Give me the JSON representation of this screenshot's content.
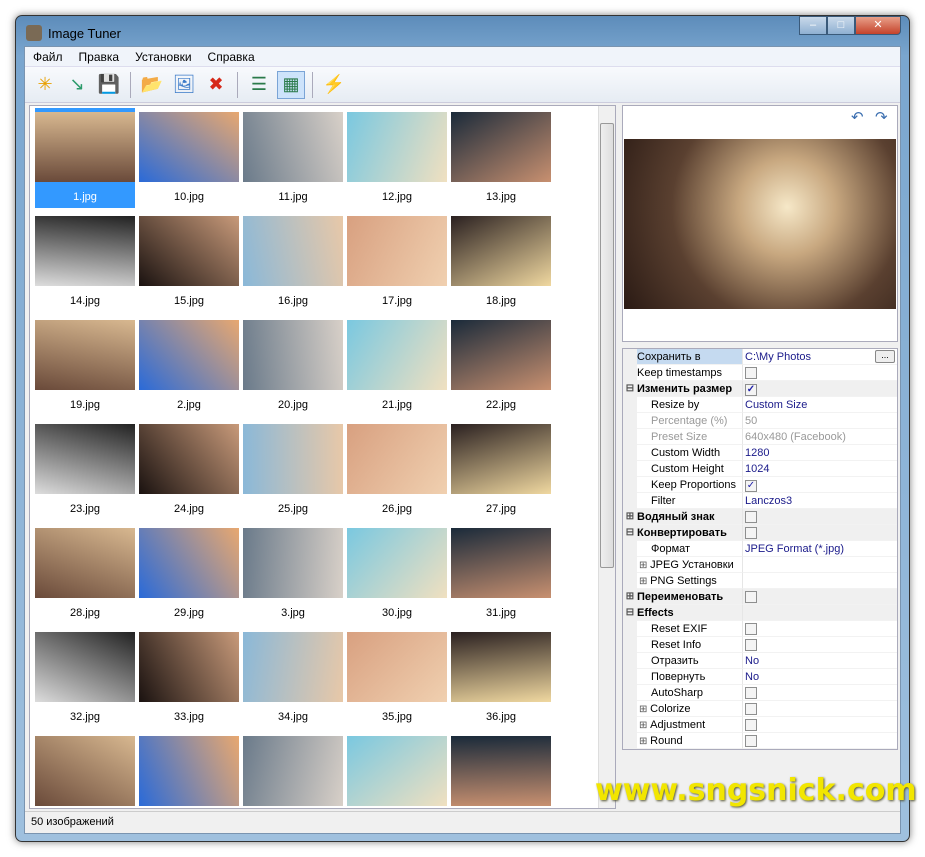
{
  "window": {
    "title": "Image Tuner"
  },
  "menu": [
    "Файл",
    "Правка",
    "Установки",
    "Справка"
  ],
  "toolbar": [
    "new-icon",
    "new-from-icon",
    "save-icon",
    "open-folder-icon",
    "add-images-icon",
    "delete-icon",
    "details-view-icon",
    "thumbnail-view-icon",
    "process-icon"
  ],
  "toolbar_glyphs": [
    "✳",
    "↘",
    "💾",
    "📂",
    "🖼",
    "✖",
    "☰",
    "▦",
    "⚡"
  ],
  "files": [
    "1.jpg",
    "10.jpg",
    "11.jpg",
    "12.jpg",
    "13.jpg",
    "14.jpg",
    "15.jpg",
    "16.jpg",
    "17.jpg",
    "18.jpg",
    "19.jpg",
    "2.jpg",
    "20.jpg",
    "21.jpg",
    "22.jpg",
    "23.jpg",
    "24.jpg",
    "25.jpg",
    "26.jpg",
    "27.jpg",
    "28.jpg",
    "29.jpg",
    "3.jpg",
    "30.jpg",
    "31.jpg",
    "32.jpg",
    "33.jpg",
    "34.jpg",
    "35.jpg",
    "36.jpg",
    "",
    "",
    "",
    "",
    ""
  ],
  "selected": "1.jpg",
  "properties": [
    {
      "name": "Сохранить в",
      "value": "C:\\My Photos",
      "type": "browse",
      "hl": true
    },
    {
      "name": "Keep timestamps",
      "check": false
    },
    {
      "name": "Изменить размер",
      "check": true,
      "cat": "minus"
    },
    {
      "name": "Resize by",
      "value": "Custom Size",
      "indent": true
    },
    {
      "name": "Percentage (%)",
      "value": "50",
      "indent": true,
      "dis": true
    },
    {
      "name": "Preset Size",
      "value": "640x480 (Facebook)",
      "indent": true,
      "dis": true
    },
    {
      "name": "Custom Width",
      "value": "1280",
      "indent": true
    },
    {
      "name": "Custom Height",
      "value": "1024",
      "indent": true
    },
    {
      "name": "Keep Proportions",
      "check": true,
      "indent": true
    },
    {
      "name": "Filter",
      "value": "Lanczos3",
      "indent": true
    },
    {
      "name": "Водяный знак",
      "check": false,
      "cat": "plus"
    },
    {
      "name": "Конвертировать",
      "check": false,
      "cat": "minus"
    },
    {
      "name": "Формат",
      "value": "JPEG Format (*.jpg)",
      "indent": true
    },
    {
      "name": "JPEG Установки",
      "exp": "plus",
      "indent": true
    },
    {
      "name": "PNG Settings",
      "exp": "plus",
      "indent": true
    },
    {
      "name": "Переименовать",
      "check": false,
      "cat": "plus"
    },
    {
      "name": "Effects",
      "cat": "minus"
    },
    {
      "name": "Reset EXIF",
      "check": false,
      "indent": true
    },
    {
      "name": "Reset Info",
      "check": false,
      "indent": true
    },
    {
      "name": "Отразить",
      "value": "No",
      "indent": true
    },
    {
      "name": "Повернуть",
      "value": "No",
      "indent": true
    },
    {
      "name": "AutoSharp",
      "check": false,
      "indent": true
    },
    {
      "name": "Colorize",
      "check": false,
      "indent": true,
      "exp": "plus"
    },
    {
      "name": "Adjustment",
      "check": false,
      "indent": true,
      "exp": "plus"
    },
    {
      "name": "Round",
      "check": false,
      "indent": true,
      "exp": "plus"
    }
  ],
  "status": "50 изображений",
  "watermark": "www.sngsnick.com"
}
